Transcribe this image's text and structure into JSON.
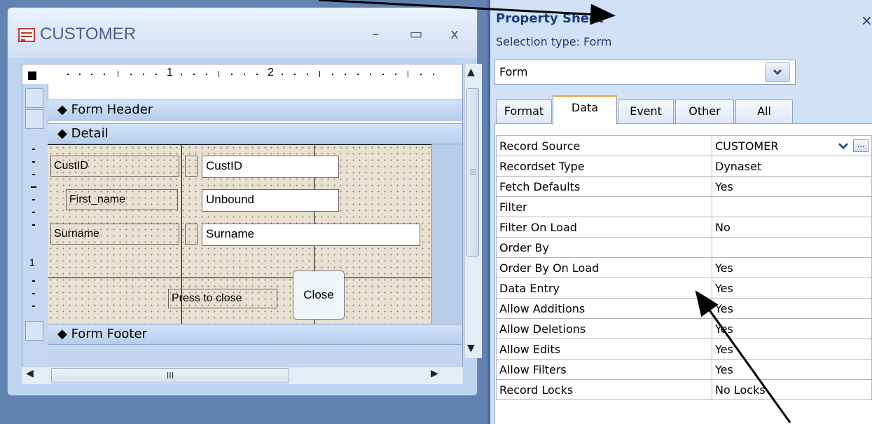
{
  "form_window": {
    "title": "CUSTOMER",
    "minimize": "–",
    "maximize": "▭",
    "close": "x",
    "ruler_numbers": [
      "1",
      "2"
    ],
    "vruler_number": "1",
    "sections": {
      "header": "Form Header",
      "detail": "Detail",
      "footer": "Form Footer"
    },
    "labels": {
      "custid": "CustID",
      "first_name": "First_name",
      "surname": "Surname",
      "press": "Press to close"
    },
    "textboxes": {
      "custid": "CustID",
      "first_name": "Unbound",
      "surname": "Surname"
    },
    "close_button": "Close",
    "hscroll_thumb": "III"
  },
  "property_sheet": {
    "title": "Property Sheet",
    "close": "×",
    "selection_type": "Selection type:  Form",
    "object_selector": "Form",
    "tabs": [
      "Format",
      "Data",
      "Event",
      "Other",
      "All"
    ],
    "active_tab": "Data",
    "properties": [
      {
        "name": "Record Source",
        "value": "CUSTOMER"
      },
      {
        "name": "Recordset Type",
        "value": "Dynaset"
      },
      {
        "name": "Fetch Defaults",
        "value": "Yes"
      },
      {
        "name": "Filter",
        "value": ""
      },
      {
        "name": "Filter On Load",
        "value": "No"
      },
      {
        "name": "Order By",
        "value": ""
      },
      {
        "name": "Order By On Load",
        "value": "Yes"
      },
      {
        "name": "Data Entry",
        "value": "Yes"
      },
      {
        "name": "Allow Additions",
        "value": "Yes"
      },
      {
        "name": "Allow Deletions",
        "value": "Yes"
      },
      {
        "name": "Allow Edits",
        "value": "Yes"
      },
      {
        "name": "Allow Filters",
        "value": "Yes"
      },
      {
        "name": "Record Locks",
        "value": "No Locks"
      }
    ],
    "build_button": "..."
  },
  "colors": {
    "app_background": "#6282b1",
    "property_sheet_bg": "#d1e2f6",
    "title_text": "#1c3b7a",
    "active_tab_accent": "#f0a43a"
  },
  "icons": [
    "form-view-icon",
    "form-section-marker-icon",
    "dropdown-chevron-icon",
    "build-ellipsis-icon",
    "scroll-arrow-icon"
  ]
}
